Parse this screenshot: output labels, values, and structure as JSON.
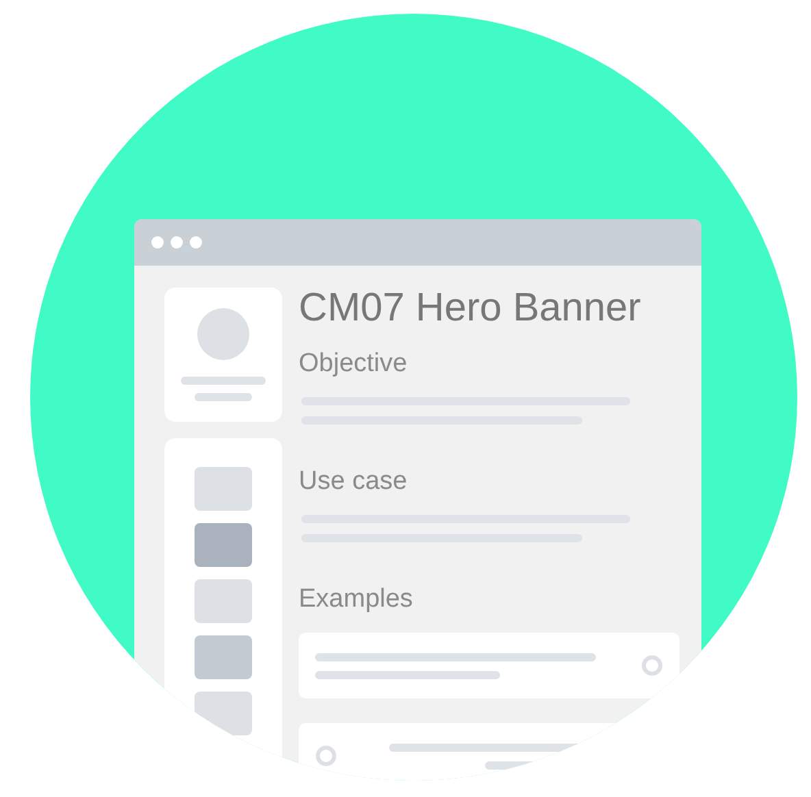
{
  "page": {
    "title": "CM07 Hero Banner"
  },
  "sidebar": {
    "items": [
      {
        "color": "#dde1e6"
      },
      {
        "color": "#a9b2bd"
      },
      {
        "color": "#dde1e6"
      },
      {
        "color": "#c3cad2"
      },
      {
        "color": "#dde1e6"
      }
    ]
  },
  "sections": [
    {
      "heading": "Objective"
    },
    {
      "heading": "Use case"
    },
    {
      "heading": "Examples"
    }
  ],
  "examples": [
    {
      "kind": "icon-right"
    },
    {
      "kind": "icon-left"
    }
  ]
}
